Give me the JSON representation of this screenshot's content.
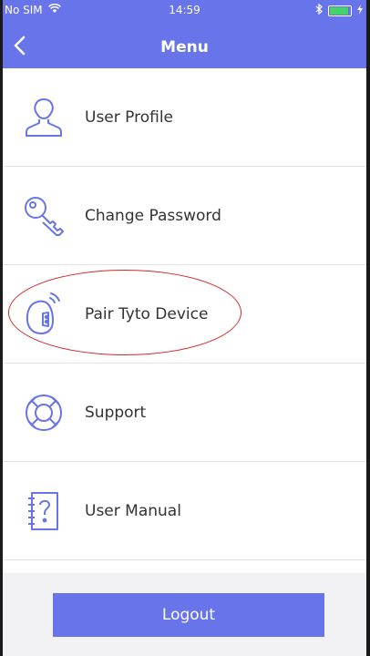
{
  "status_bar": {
    "carrier": "No SIM",
    "time": "14:59",
    "battery_level": 0.84,
    "icons": [
      "wifi-icon",
      "bluetooth-icon",
      "battery-icon",
      "charging-icon"
    ]
  },
  "header": {
    "title": "Menu",
    "back_icon": "chevron-left-icon"
  },
  "menu": {
    "items": [
      {
        "label": "User Profile",
        "icon": "user-icon"
      },
      {
        "label": "Change Password",
        "icon": "key-icon"
      },
      {
        "label": "Pair Tyto Device",
        "icon": "device-pair-icon"
      },
      {
        "label": "Support",
        "icon": "lifebuoy-icon"
      },
      {
        "label": "User Manual",
        "icon": "manual-icon"
      }
    ]
  },
  "footer": {
    "logout_label": "Logout"
  },
  "colors": {
    "accent": "#6874ea",
    "annotation": "#d22a2a",
    "footer_bg": "#f2f2f4"
  }
}
